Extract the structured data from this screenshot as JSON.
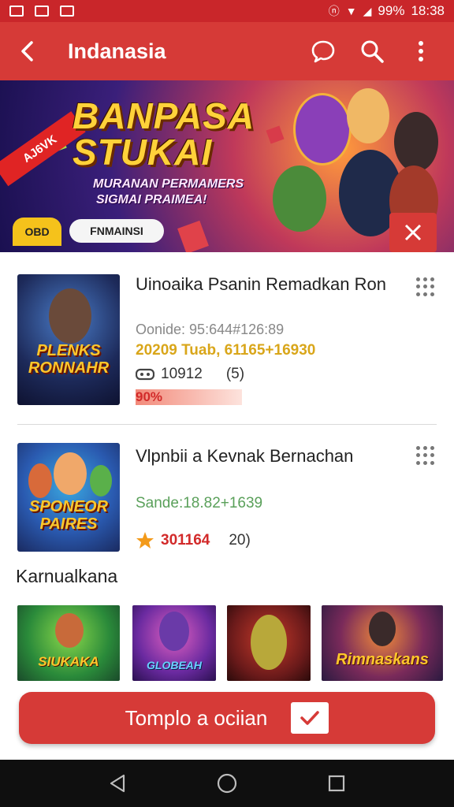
{
  "status_bar": {
    "battery": "99%",
    "time": "18:38"
  },
  "app_bar": {
    "title": "Indanasia"
  },
  "banner": {
    "badge": "AJ6VK",
    "title_line1": "BANPASA",
    "title_line2": "STUKAI",
    "subtitle_line1": "MURANAN PERMAMERS",
    "subtitle_line2": "SIGMAI PRAIMEA!",
    "chip_yellow": "OBD",
    "chip_white": "FNMAINSI"
  },
  "games": [
    {
      "title": "Uinoaika Psanin Remadkan Ron",
      "thumb_text": "PLENKS RONNAHR",
      "meta": "Oonide: 95:644#126:89",
      "price": "20209 Tuab, 61165+16930",
      "rating": "10912",
      "rating_count": "(5)",
      "progress_label": "90%",
      "progress": 0.9
    },
    {
      "title": "Vlpnbii a Kevnak Bernachan",
      "thumb_text": "SPONEOR PAIRES",
      "meta": "",
      "price": "Sande:18.82+1639",
      "rating": "301164",
      "rating_count": "20)"
    }
  ],
  "section": {
    "title": "Karnualkana"
  },
  "mini_games": [
    {
      "label": "SIUKAKA"
    },
    {
      "label": "GLOBEAH"
    },
    {
      "label": ""
    },
    {
      "label": "Rimnaskans"
    }
  ],
  "cta": {
    "label": "Tomplo a ociian"
  },
  "icons": {
    "back": "arrow-left-icon",
    "chat": "chat-bubble-icon",
    "search": "search-icon",
    "more": "more-vert-icon",
    "close": "close-icon",
    "check": "check-icon",
    "star": "star-icon"
  },
  "colors": {
    "primary": "#d63a37",
    "status_bar": "#c9262a",
    "price": "#d9a61a",
    "progress": "#d22a2a"
  }
}
